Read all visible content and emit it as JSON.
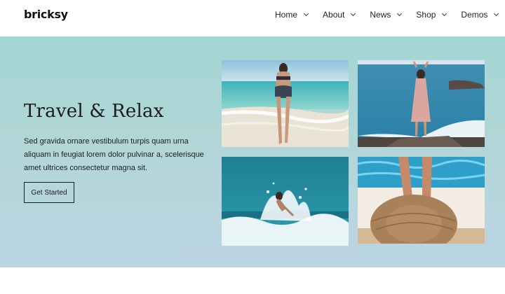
{
  "header": {
    "logo": "bricksy",
    "nav": [
      {
        "label": "Home"
      },
      {
        "label": "About"
      },
      {
        "label": "News"
      },
      {
        "label": "Shop"
      },
      {
        "label": "Demos"
      }
    ]
  },
  "hero": {
    "title": "Travel & Relax",
    "text": "Sed gravida ornare vestibulum turpis quam urna aliquam in feugiat lorem dolor pulvinar a, scelerisque amet ultrices consectetur magna sit.",
    "cta_label": "Get Started"
  },
  "icons": {
    "nav_dropdown": "chevron-down-icon"
  },
  "colors": {
    "hero_top": "#a4d6d3",
    "hero_bottom": "#bcd5e4",
    "text": "#1c1c1c"
  }
}
